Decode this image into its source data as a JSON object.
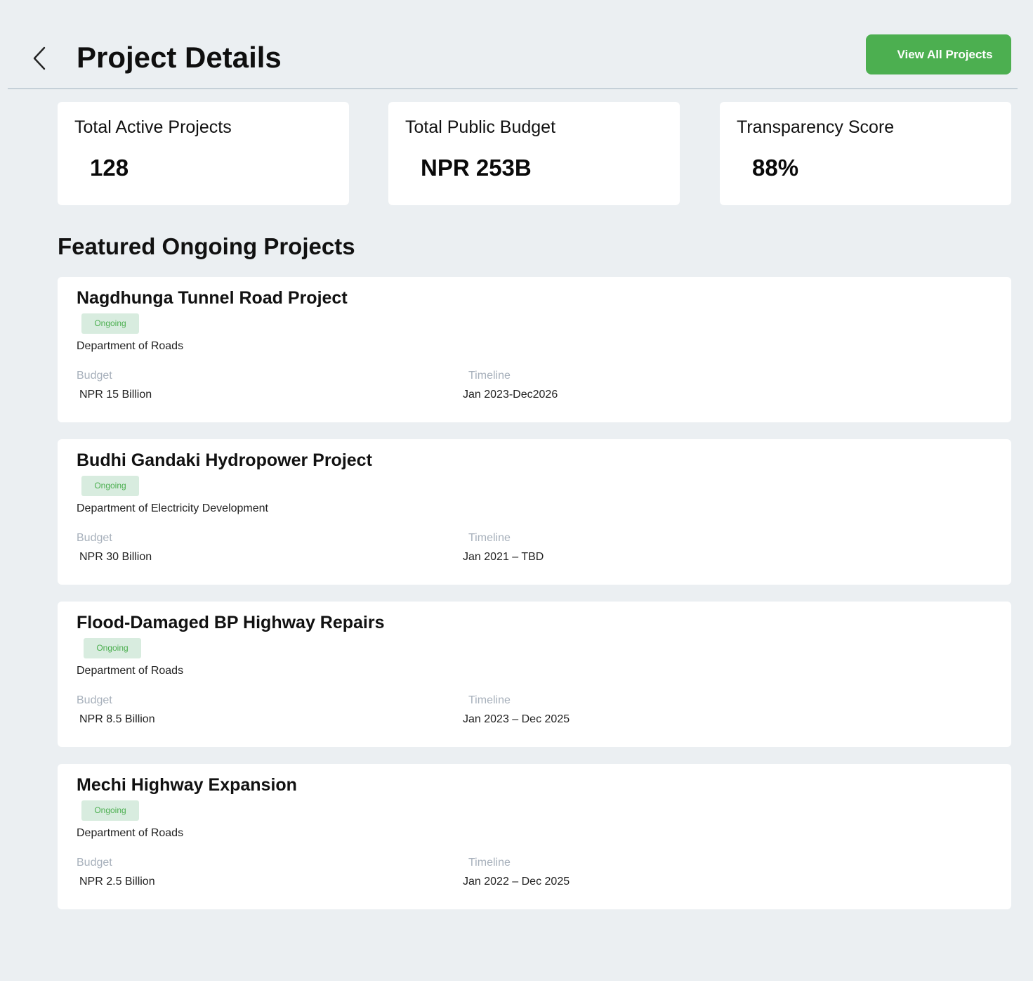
{
  "header": {
    "title": "Project Details",
    "back_icon": "chevron-left-icon",
    "view_all_label": "View All Projects",
    "accent_color": "#4caf50"
  },
  "stats": [
    {
      "label": "Total Active Projects",
      "value": "128"
    },
    {
      "label": "Total Public Budget",
      "value": "NPR 253B"
    },
    {
      "label": "Transparency Score",
      "value": "88%"
    }
  ],
  "featured": {
    "title": "Featured Ongoing Projects",
    "budget_label": "Budget",
    "timeline_label": "Timeline",
    "projects": [
      {
        "name": "Nagdhunga Tunnel Road Project",
        "status": "Ongoing",
        "department": "Department of Roads",
        "budget": "NPR 15 Billion",
        "timeline": "Jan 2023-Dec2026"
      },
      {
        "name": "Budhi Gandaki Hydropower Project",
        "status": "Ongoing",
        "department": "Department of Electricity Development",
        "budget": "NPR 30 Billion",
        "timeline": "Jan 2021 – TBD"
      },
      {
        "name": "Flood-Damaged BP Highway Repairs",
        "status": "Ongoing",
        "department": "Department of Roads",
        "budget": "NPR 8.5 Billion",
        "timeline": "Jan 2023 – Dec 2025"
      },
      {
        "name": "Mechi Highway Expansion",
        "status": "Ongoing",
        "department": "Department of Roads",
        "budget": "NPR 2.5 Billion",
        "timeline": "Jan 2022 – Dec 2025"
      }
    ]
  }
}
